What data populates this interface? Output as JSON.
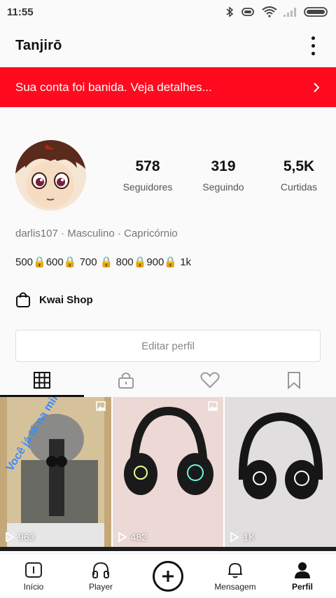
{
  "status_bar": {
    "time": "11:55"
  },
  "header": {
    "title": "Tanjirō"
  },
  "banner": {
    "text": "Sua conta foi banida. Veja detalhes...",
    "color": "#ff0a1e"
  },
  "profile": {
    "stats": [
      {
        "value": "578",
        "label": "Seguidores"
      },
      {
        "value": "319",
        "label": "Seguindo"
      },
      {
        "value": "5,5K",
        "label": "Curtidas"
      }
    ],
    "meta": "darlis107 · Masculino · Capricórnio",
    "bio": "500🔒600🔒 700 🔒 800🔒900🔒 1k"
  },
  "shop": {
    "label": "Kwai Shop"
  },
  "edit_button": {
    "label": "Editar perfil"
  },
  "tabs": [
    "grid-icon",
    "lock-icon",
    "heart-icon",
    "bookmark-icon"
  ],
  "videos": [
    {
      "views": "963",
      "overlay": "Você já tá na mira"
    },
    {
      "views": "482"
    },
    {
      "views": "1K"
    }
  ],
  "bottom_nav": [
    {
      "label": "Início",
      "icon": "home-icon"
    },
    {
      "label": "Player",
      "icon": "headphones-icon"
    },
    {
      "label": "",
      "icon": "plus-icon"
    },
    {
      "label": "Mensagem",
      "icon": "bell-icon"
    },
    {
      "label": "Perfil",
      "icon": "person-icon"
    }
  ]
}
